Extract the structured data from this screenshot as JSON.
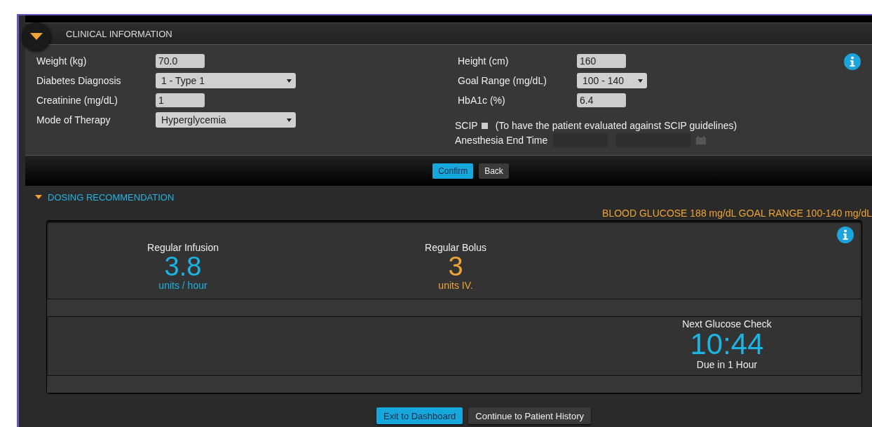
{
  "clinical": {
    "title": "CLINICAL INFORMATION",
    "expanded": true,
    "left_fields": [
      {
        "label": "Weight (kg)",
        "kind": "input",
        "value": "70.0"
      },
      {
        "label": "Diabetes Diagnosis",
        "kind": "select",
        "value": "1 - Type 1"
      },
      {
        "label": "Creatinine (mg/dL)",
        "kind": "input",
        "value": "1"
      },
      {
        "label": "Mode of Therapy",
        "kind": "select",
        "value": "Hyperglycemia"
      }
    ],
    "right_fields": [
      {
        "label": "Height (cm)",
        "kind": "input",
        "value": "160"
      },
      {
        "label": "Goal Range (mg/dL)",
        "kind": "select",
        "value": "100 - 140"
      },
      {
        "label": "HbA1c (%)",
        "kind": "input",
        "value": "6.4"
      }
    ],
    "scip": {
      "label": "SCIP",
      "checked": false,
      "note": "(To have the patient evaluated against SCIP guidelines)"
    },
    "anesthesia": {
      "label": "Anesthesia End Time"
    },
    "buttons": [
      {
        "label": "Confirm",
        "primary": true
      },
      {
        "label": "Back",
        "primary": false
      }
    ]
  },
  "dosing": {
    "title": "DOSING RECOMMENDATION",
    "expanded": true,
    "summary": "BLOOD GLUCOSE 188 mg/dL GOAL RANGE 100-140 mg/dL",
    "doses": [
      {
        "label": "Regular Infusion",
        "value": "3.8",
        "unit": "units / hour",
        "color": "#1cb4e4"
      },
      {
        "label": "Regular Bolus",
        "value": "3",
        "unit": "units IV.",
        "color": "#f0a436"
      }
    ],
    "next_check": {
      "label": "Next Glucose Check",
      "time": "10:44",
      "due": "Due in 1 Hour"
    },
    "buttons": [
      {
        "label": "Exit to Dashboard",
        "primary": true
      },
      {
        "label": "Continue to Patient History",
        "primary": false
      }
    ]
  }
}
